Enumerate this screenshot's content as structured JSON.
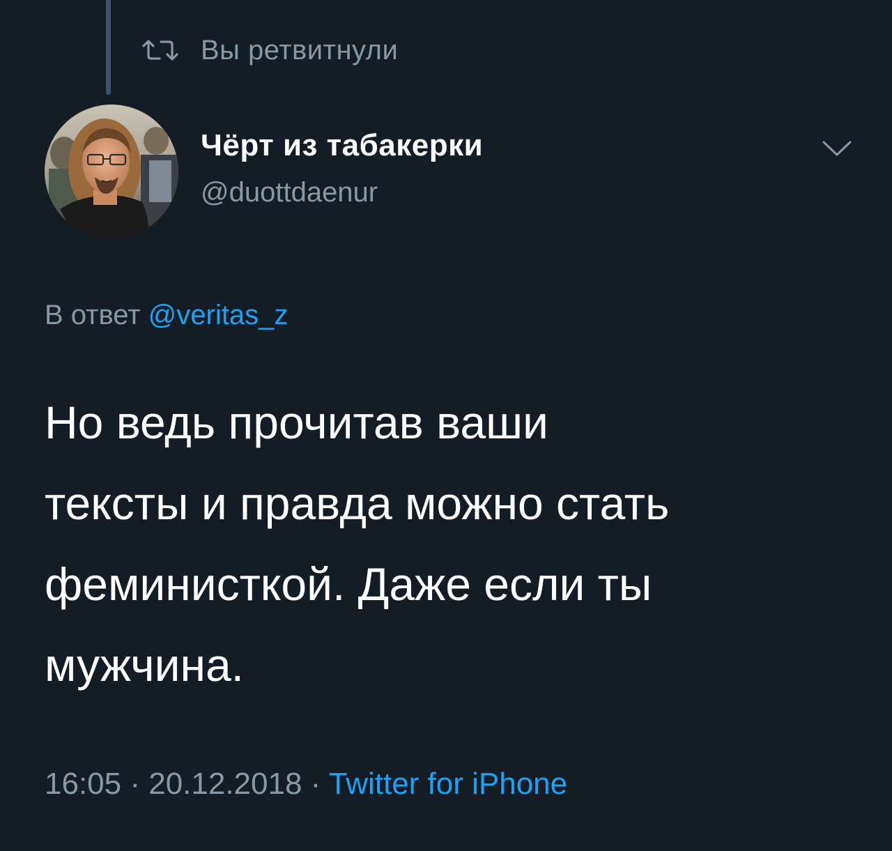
{
  "retweet": {
    "label": "Вы ретвитнули",
    "icon": "retweet-icon"
  },
  "author": {
    "display_name": "Чёрт из табакерки",
    "username": "@duottdaenur",
    "avatar_icon": "avatar-photo"
  },
  "menu": {
    "icon": "chevron-down-icon"
  },
  "reply": {
    "prefix": "В ответ",
    "handle": "@veritas_z"
  },
  "tweet": {
    "lines": [
      "Но ведь прочитав ваши",
      "тексты и правда можно стать",
      "феминисткой. Даже если ты",
      "мужчина."
    ]
  },
  "meta": {
    "time": "16:05",
    "separator": " · ",
    "date": "20.12.2018",
    "source": "Twitter for iPhone"
  },
  "colors": {
    "background": "#141d26",
    "text_primary": "#ffffff",
    "text_secondary": "#8899a6",
    "accent_link": "#1da1f2",
    "thread_line": "#3d5466"
  }
}
